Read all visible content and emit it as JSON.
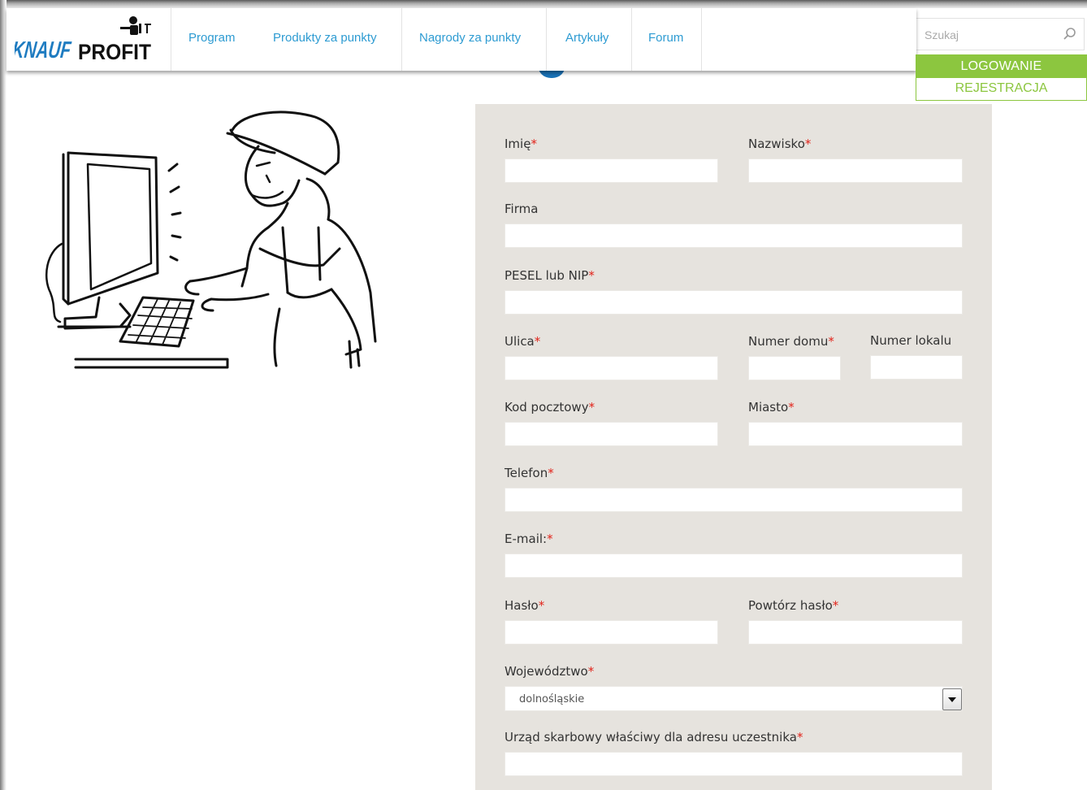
{
  "header": {
    "logo_text_knauf": "KNAUF",
    "logo_text_profit": "PROFIT",
    "nav": [
      "Program",
      "Produkty za punkty",
      "Nagrody za punkty",
      "Artykuły",
      "Forum"
    ]
  },
  "search": {
    "placeholder": "Szukaj"
  },
  "auth": {
    "login": "LOGOWANIE",
    "register": "REJESTRACJA"
  },
  "form": {
    "required_mark": "*",
    "first_name": "Imię",
    "last_name": "Nazwisko",
    "company": "Firma",
    "pesel_nip": "PESEL lub NIP",
    "street": "Ulica",
    "house_number": "Numer domu",
    "apartment_number": "Numer lokalu",
    "postal_code": "Kod pocztowy",
    "city": "Miasto",
    "phone": "Telefon",
    "email": "E-mail:",
    "password": "Hasło",
    "password_repeat": "Powtórz hasło",
    "voivodeship": "Województwo",
    "voivodeship_value": "dolnośląskie",
    "tax_office": "Urząd skarbowy właściwy dla adresu uczestnika"
  },
  "colors": {
    "nav_link": "#2d9bd2",
    "accent_green": "#8cc63f",
    "form_bg": "#e6e3de",
    "required": "#e2231a",
    "brand_blue": "#1a73b7"
  }
}
